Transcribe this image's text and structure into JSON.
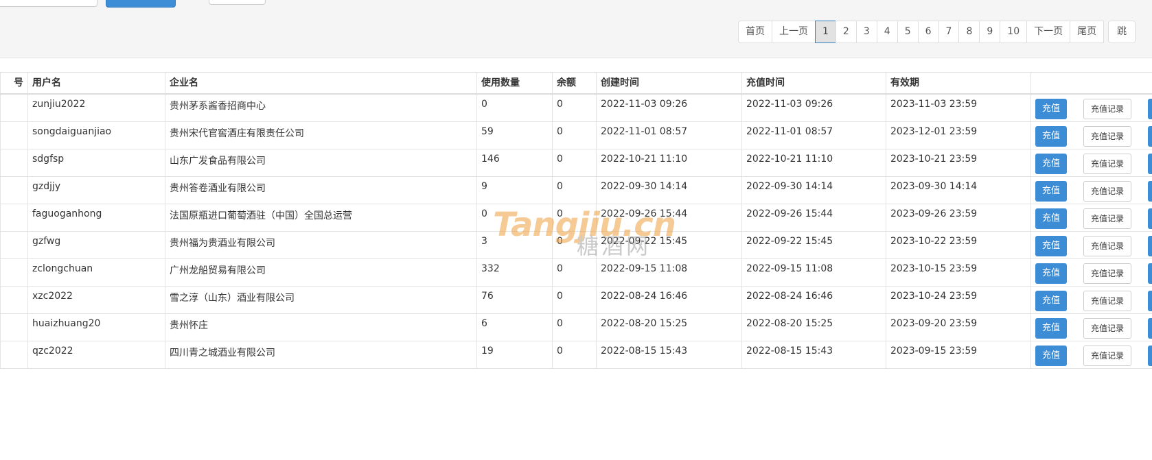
{
  "pagination": {
    "items": [
      "首页",
      "上一页",
      "1",
      "2",
      "3",
      "4",
      "5",
      "6",
      "7",
      "8",
      "9",
      "10",
      "下一页",
      "尾页"
    ],
    "active": "1",
    "jump_label": "跳"
  },
  "table": {
    "headers": [
      "号",
      "用户名",
      "企业名",
      "使用数量",
      "余额",
      "创建时间",
      "充值时间",
      "有效期",
      ""
    ],
    "rows": [
      {
        "username": "zunjiu2022",
        "company": "贵州茅系酱香招商中心",
        "usage": "0",
        "balance": "0",
        "created": "2022-11-03 09:26",
        "recharged": "2022-11-03 09:26",
        "expiry": "2023-11-03 23:59"
      },
      {
        "username": "songdaiguanjiao",
        "company": "贵州宋代官窖酒庄有限责任公司",
        "usage": "59",
        "balance": "0",
        "created": "2022-11-01 08:57",
        "recharged": "2022-11-01 08:57",
        "expiry": "2023-12-01 23:59"
      },
      {
        "username": "sdgfsp",
        "company": "山东广发食品有限公司",
        "usage": "146",
        "balance": "0",
        "created": "2022-10-21 11:10",
        "recharged": "2022-10-21 11:10",
        "expiry": "2023-10-21 23:59"
      },
      {
        "username": "gzdjjy",
        "company": "贵州答卷酒业有限公司",
        "usage": "9",
        "balance": "0",
        "created": "2022-09-30 14:14",
        "recharged": "2022-09-30 14:14",
        "expiry": "2023-09-30 14:14"
      },
      {
        "username": "faguoganhong",
        "company": "法国原瓶进口葡萄酒驻（中国）全国总运营",
        "usage": "0",
        "balance": "0",
        "created": "2022-09-26 15:44",
        "recharged": "2022-09-26 15:44",
        "expiry": "2023-09-26 23:59"
      },
      {
        "username": "gzfwg",
        "company": "贵州福为贵酒业有限公司",
        "usage": "3",
        "balance": "0",
        "created": "2022-09-22 15:45",
        "recharged": "2022-09-22 15:45",
        "expiry": "2023-10-22 23:59"
      },
      {
        "username": "zclongchuan",
        "company": "广州龙船贸易有限公司",
        "usage": "332",
        "balance": "0",
        "created": "2022-09-15 11:08",
        "recharged": "2022-09-15 11:08",
        "expiry": "2023-10-15 23:59"
      },
      {
        "username": "xzc2022",
        "company": "雪之淳（山东）酒业有限公司",
        "usage": "76",
        "balance": "0",
        "created": "2022-08-24 16:46",
        "recharged": "2022-08-24 16:46",
        "expiry": "2023-10-24 23:59"
      },
      {
        "username": "huaizhuang20",
        "company": "贵州怀庄",
        "usage": "6",
        "balance": "0",
        "created": "2022-08-20 15:25",
        "recharged": "2022-08-20 15:25",
        "expiry": "2023-09-20 23:59"
      },
      {
        "username": "qzc2022",
        "company": "四川青之城酒业有限公司",
        "usage": "19",
        "balance": "0",
        "created": "2022-08-15 15:43",
        "recharged": "2022-08-15 15:43",
        "expiry": "2023-09-15 23:59"
      }
    ],
    "recharge_label": "充值",
    "history_label": "充值记录"
  },
  "watermark": {
    "logo_text": "Tangjiu.cn",
    "cn_text": "糖酒网"
  },
  "colors": {
    "primary": "#3c8dd6",
    "panel_bg": "#f5f5f5",
    "watermark_orange": "#f0a040"
  }
}
